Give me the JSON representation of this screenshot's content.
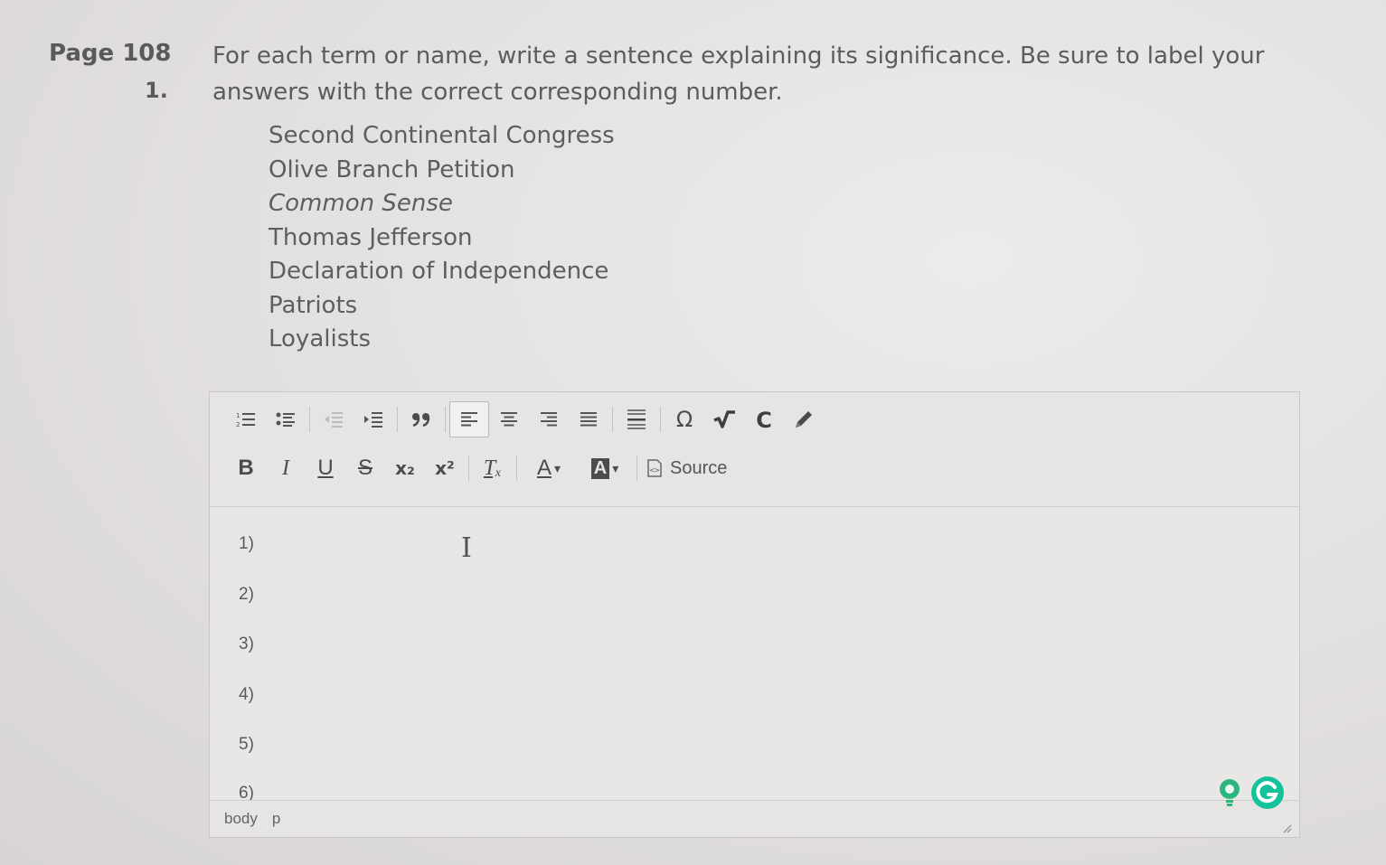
{
  "question": {
    "page_label": "Page 108",
    "number": "1.",
    "prompt": "For each term or name, write a sentence explaining its significance. Be sure to label your answers with the correct corresponding number."
  },
  "terms": [
    {
      "text": "Second Continental Congress",
      "italic": false
    },
    {
      "text": "Olive Branch Petition",
      "italic": false
    },
    {
      "text": "Common Sense",
      "italic": true
    },
    {
      "text": "Thomas Jefferson",
      "italic": false
    },
    {
      "text": "Declaration of Independence",
      "italic": false
    },
    {
      "text": "Patriots",
      "italic": false
    },
    {
      "text": "Loyalists",
      "italic": false
    }
  ],
  "toolbar": {
    "row1_icons": [
      "numbered-list-icon",
      "bulleted-list-icon",
      "decrease-indent-icon",
      "increase-indent-icon",
      "blockquote-icon",
      "align-left-icon",
      "align-center-icon",
      "align-right-icon",
      "justify-icon",
      "horizontal-rule-icon",
      "special-character-icon",
      "math-root-icon",
      "c-icon",
      "pencil-icon"
    ],
    "row2_icons": [
      "bold-icon",
      "italic-icon",
      "underline-icon",
      "strikethrough-icon",
      "subscript-icon",
      "superscript-icon",
      "remove-format-icon",
      "text-color-icon",
      "background-color-icon"
    ],
    "source_label": "Source",
    "bold_glyph": "B",
    "italic_glyph": "I",
    "underline_glyph": "U",
    "strike_glyph": "S",
    "subscript_glyph": "x₂",
    "superscript_glyph": "x²",
    "removeformat_glyph": "Tₓ",
    "textcolor_glyph": "A",
    "bgcolor_glyph": "A"
  },
  "editor": {
    "lines": [
      "1)",
      "2)",
      "3)",
      "4)",
      "5)",
      "6)"
    ]
  },
  "statusbar": {
    "path": [
      "body",
      "p"
    ]
  },
  "colors": {
    "grammarly_green": "#15c39a",
    "tip_green": "#2fb57e"
  }
}
